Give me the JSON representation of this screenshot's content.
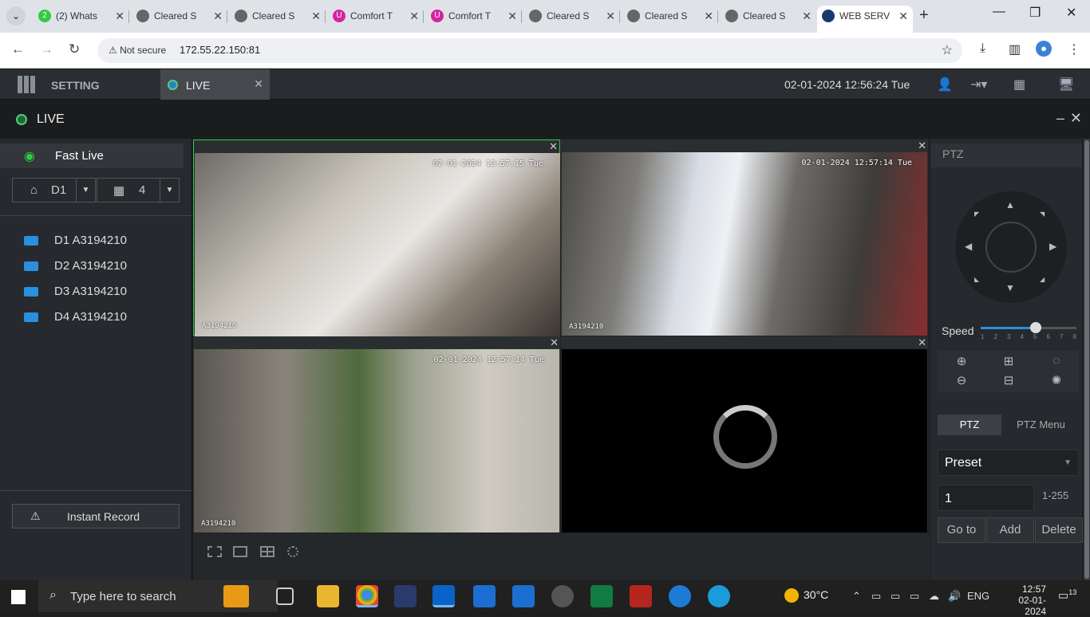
{
  "browser": {
    "tabs": [
      {
        "title": "(2) Whats",
        "icon": "whatsapp-icon"
      },
      {
        "title": "Cleared S",
        "icon": "globe-icon"
      },
      {
        "title": "Cleared S",
        "icon": "globe-icon"
      },
      {
        "title": "Comfort T",
        "icon": "comfort-icon"
      },
      {
        "title": "Comfort T",
        "icon": "comfort-icon"
      },
      {
        "title": "Cleared S",
        "icon": "globe-icon"
      },
      {
        "title": "Cleared S",
        "icon": "globe-icon"
      },
      {
        "title": "Cleared S",
        "icon": "globe-icon"
      },
      {
        "title": "WEB SERV",
        "icon": "web-service-icon"
      }
    ],
    "security_label": "Not secure",
    "url": "172.55.22.150:81"
  },
  "app": {
    "setting_label": "SETTING",
    "live_tab_label": "LIVE",
    "datetime": "02-01-2024 12:56:24 Tue",
    "page_title": "LIVE"
  },
  "sidebar": {
    "fast_live_label": "Fast Live",
    "device_select": "D1",
    "layout_select": "4",
    "cameras": [
      {
        "label": "D1 A3194210"
      },
      {
        "label": "D2 A3194210"
      },
      {
        "label": "D3 A3194210"
      },
      {
        "label": "D4 A3194210"
      }
    ],
    "instant_record_label": "Instant Record"
  },
  "panes": [
    {
      "timestamp": "02-01-2024 12:57:15 Tue",
      "camera": "A3194210",
      "selected": true
    },
    {
      "timestamp": "02-01-2024 12:57:14 Tue",
      "camera": "A3194210",
      "selected": false
    },
    {
      "timestamp": "02-01-2024 12:57:14 Tue",
      "camera": "A3194210",
      "selected": false
    },
    {
      "timestamp": "",
      "camera": "",
      "selected": false,
      "loading": true
    }
  ],
  "ptz": {
    "title": "PTZ",
    "speed_label": "Speed",
    "speed_ticks": [
      "1",
      "2",
      "3",
      "4",
      "5",
      "6",
      "7",
      "8"
    ],
    "speed_value": 5,
    "tab_ptz": "PTZ",
    "tab_menu": "PTZ Menu",
    "preset_select": "Preset",
    "preset_value": "1",
    "preset_range": "1-255",
    "btn_goto": "Go to",
    "btn_add": "Add",
    "btn_delete": "Delete"
  },
  "taskbar": {
    "search_placeholder": "Type here to search",
    "weather": "30°C",
    "language": "ENG",
    "time": "12:57",
    "date": "02-01-2024",
    "notifications": "13"
  }
}
